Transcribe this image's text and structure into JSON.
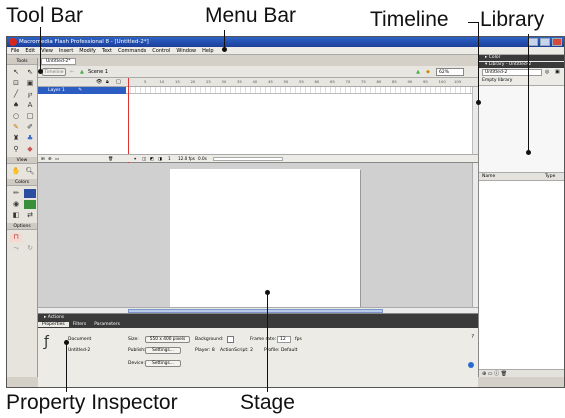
{
  "annotations": {
    "tool_bar": "Tool Bar",
    "menu_bar": "Menu Bar",
    "timeline": "Timeline",
    "library": "Library",
    "property_inspector": "Property Inspector",
    "stage": "Stage"
  },
  "window": {
    "title": "Macromedia Flash Professional 8 - [Untitled-2*]"
  },
  "menu": [
    "File",
    "Edit",
    "View",
    "Insert",
    "Modify",
    "Text",
    "Commands",
    "Control",
    "Window",
    "Help"
  ],
  "tools": {
    "header": "Tools",
    "view_header": "View",
    "colors_header": "Colors",
    "options_header": "Options"
  },
  "document": {
    "tab": "Untitled-2*",
    "timeline_button": "Timeline",
    "scene": "Scene 1",
    "zoom": "62%"
  },
  "timeline": {
    "frame_numbers": [
      "5",
      "10",
      "15",
      "20",
      "25",
      "30",
      "35",
      "40",
      "45",
      "50",
      "55",
      "60",
      "65",
      "70",
      "75",
      "80",
      "85",
      "90",
      "95",
      "100",
      "105"
    ],
    "layer_name": "Layer 1",
    "status_frame": "1",
    "status_fps": "12.0 fps",
    "status_time": "0.0s"
  },
  "panels": {
    "color": "Color",
    "library": "Library - Untitled-2",
    "library_select": "Untitled-2",
    "library_empty": "Empty library",
    "name_col": "Name",
    "type_col": "Type"
  },
  "properties": {
    "actions": "Actions",
    "tabs": [
      "Properties",
      "Filters",
      "Parameters"
    ],
    "doc_label": "Document",
    "doc_name": "Untitled-2",
    "size_label": "Size:",
    "size_value": "550 x 400 pixels",
    "bg_label": "Background:",
    "framerate_label": "Frame rate:",
    "framerate_value": "12",
    "fps_label": "fps",
    "publish_label": "Publish:",
    "settings_btn": "Settings...",
    "player": "Player: 8",
    "actionscript": "ActionScript: 2",
    "profile": "Profile: Default",
    "device_label": "Device:"
  }
}
